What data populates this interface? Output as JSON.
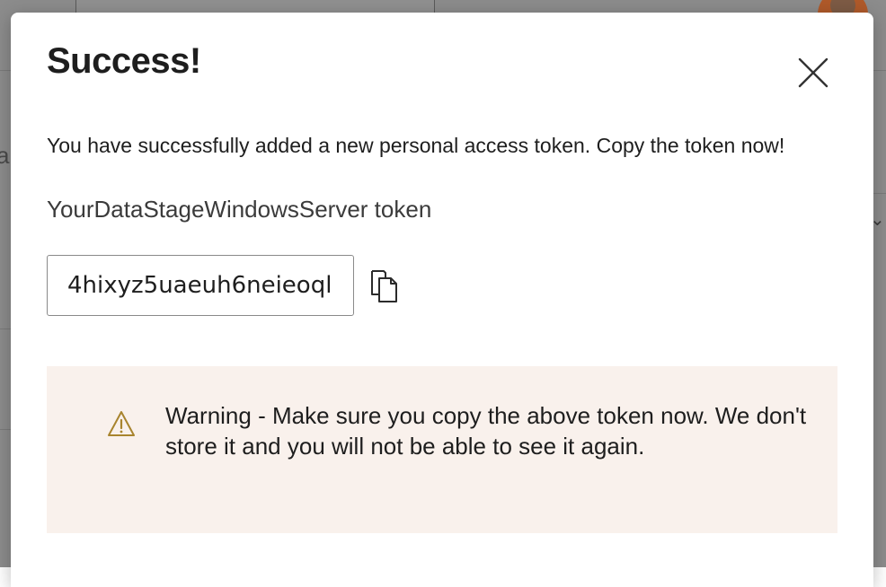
{
  "dialog": {
    "title": "Success!",
    "message": "You have successfully added a new personal access token. Copy the token now!",
    "token_name": "YourDataStageWindowsServer token",
    "token_value": "4hixyz5uaeuh6neieoql",
    "close_icon": "close-icon",
    "copy_icon": "copy-icon"
  },
  "warning": {
    "icon": "warning-icon",
    "text": "Warning - Make sure you copy the above token now. We don't store it and you will not be able to see it again.",
    "background_color": "#f9f1ec",
    "icon_color": "#a8842e"
  },
  "background_page": {
    "left_text": "a"
  }
}
